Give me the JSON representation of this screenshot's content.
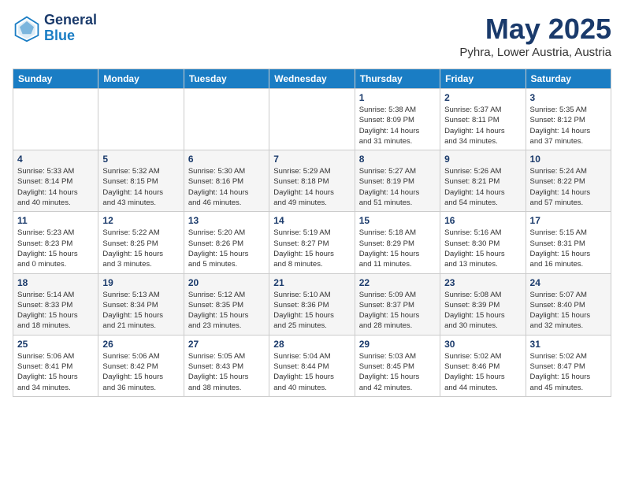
{
  "logo": {
    "line1": "General",
    "line2": "Blue"
  },
  "title": "May 2025",
  "subtitle": "Pyhra, Lower Austria, Austria",
  "days_of_week": [
    "Sunday",
    "Monday",
    "Tuesday",
    "Wednesday",
    "Thursday",
    "Friday",
    "Saturday"
  ],
  "weeks": [
    [
      {
        "day": "",
        "info": ""
      },
      {
        "day": "",
        "info": ""
      },
      {
        "day": "",
        "info": ""
      },
      {
        "day": "",
        "info": ""
      },
      {
        "day": "1",
        "info": "Sunrise: 5:38 AM\nSunset: 8:09 PM\nDaylight: 14 hours\nand 31 minutes."
      },
      {
        "day": "2",
        "info": "Sunrise: 5:37 AM\nSunset: 8:11 PM\nDaylight: 14 hours\nand 34 minutes."
      },
      {
        "day": "3",
        "info": "Sunrise: 5:35 AM\nSunset: 8:12 PM\nDaylight: 14 hours\nand 37 minutes."
      }
    ],
    [
      {
        "day": "4",
        "info": "Sunrise: 5:33 AM\nSunset: 8:14 PM\nDaylight: 14 hours\nand 40 minutes."
      },
      {
        "day": "5",
        "info": "Sunrise: 5:32 AM\nSunset: 8:15 PM\nDaylight: 14 hours\nand 43 minutes."
      },
      {
        "day": "6",
        "info": "Sunrise: 5:30 AM\nSunset: 8:16 PM\nDaylight: 14 hours\nand 46 minutes."
      },
      {
        "day": "7",
        "info": "Sunrise: 5:29 AM\nSunset: 8:18 PM\nDaylight: 14 hours\nand 49 minutes."
      },
      {
        "day": "8",
        "info": "Sunrise: 5:27 AM\nSunset: 8:19 PM\nDaylight: 14 hours\nand 51 minutes."
      },
      {
        "day": "9",
        "info": "Sunrise: 5:26 AM\nSunset: 8:21 PM\nDaylight: 14 hours\nand 54 minutes."
      },
      {
        "day": "10",
        "info": "Sunrise: 5:24 AM\nSunset: 8:22 PM\nDaylight: 14 hours\nand 57 minutes."
      }
    ],
    [
      {
        "day": "11",
        "info": "Sunrise: 5:23 AM\nSunset: 8:23 PM\nDaylight: 15 hours\nand 0 minutes."
      },
      {
        "day": "12",
        "info": "Sunrise: 5:22 AM\nSunset: 8:25 PM\nDaylight: 15 hours\nand 3 minutes."
      },
      {
        "day": "13",
        "info": "Sunrise: 5:20 AM\nSunset: 8:26 PM\nDaylight: 15 hours\nand 5 minutes."
      },
      {
        "day": "14",
        "info": "Sunrise: 5:19 AM\nSunset: 8:27 PM\nDaylight: 15 hours\nand 8 minutes."
      },
      {
        "day": "15",
        "info": "Sunrise: 5:18 AM\nSunset: 8:29 PM\nDaylight: 15 hours\nand 11 minutes."
      },
      {
        "day": "16",
        "info": "Sunrise: 5:16 AM\nSunset: 8:30 PM\nDaylight: 15 hours\nand 13 minutes."
      },
      {
        "day": "17",
        "info": "Sunrise: 5:15 AM\nSunset: 8:31 PM\nDaylight: 15 hours\nand 16 minutes."
      }
    ],
    [
      {
        "day": "18",
        "info": "Sunrise: 5:14 AM\nSunset: 8:33 PM\nDaylight: 15 hours\nand 18 minutes."
      },
      {
        "day": "19",
        "info": "Sunrise: 5:13 AM\nSunset: 8:34 PM\nDaylight: 15 hours\nand 21 minutes."
      },
      {
        "day": "20",
        "info": "Sunrise: 5:12 AM\nSunset: 8:35 PM\nDaylight: 15 hours\nand 23 minutes."
      },
      {
        "day": "21",
        "info": "Sunrise: 5:10 AM\nSunset: 8:36 PM\nDaylight: 15 hours\nand 25 minutes."
      },
      {
        "day": "22",
        "info": "Sunrise: 5:09 AM\nSunset: 8:37 PM\nDaylight: 15 hours\nand 28 minutes."
      },
      {
        "day": "23",
        "info": "Sunrise: 5:08 AM\nSunset: 8:39 PM\nDaylight: 15 hours\nand 30 minutes."
      },
      {
        "day": "24",
        "info": "Sunrise: 5:07 AM\nSunset: 8:40 PM\nDaylight: 15 hours\nand 32 minutes."
      }
    ],
    [
      {
        "day": "25",
        "info": "Sunrise: 5:06 AM\nSunset: 8:41 PM\nDaylight: 15 hours\nand 34 minutes."
      },
      {
        "day": "26",
        "info": "Sunrise: 5:06 AM\nSunset: 8:42 PM\nDaylight: 15 hours\nand 36 minutes."
      },
      {
        "day": "27",
        "info": "Sunrise: 5:05 AM\nSunset: 8:43 PM\nDaylight: 15 hours\nand 38 minutes."
      },
      {
        "day": "28",
        "info": "Sunrise: 5:04 AM\nSunset: 8:44 PM\nDaylight: 15 hours\nand 40 minutes."
      },
      {
        "day": "29",
        "info": "Sunrise: 5:03 AM\nSunset: 8:45 PM\nDaylight: 15 hours\nand 42 minutes."
      },
      {
        "day": "30",
        "info": "Sunrise: 5:02 AM\nSunset: 8:46 PM\nDaylight: 15 hours\nand 44 minutes."
      },
      {
        "day": "31",
        "info": "Sunrise: 5:02 AM\nSunset: 8:47 PM\nDaylight: 15 hours\nand 45 minutes."
      }
    ]
  ]
}
